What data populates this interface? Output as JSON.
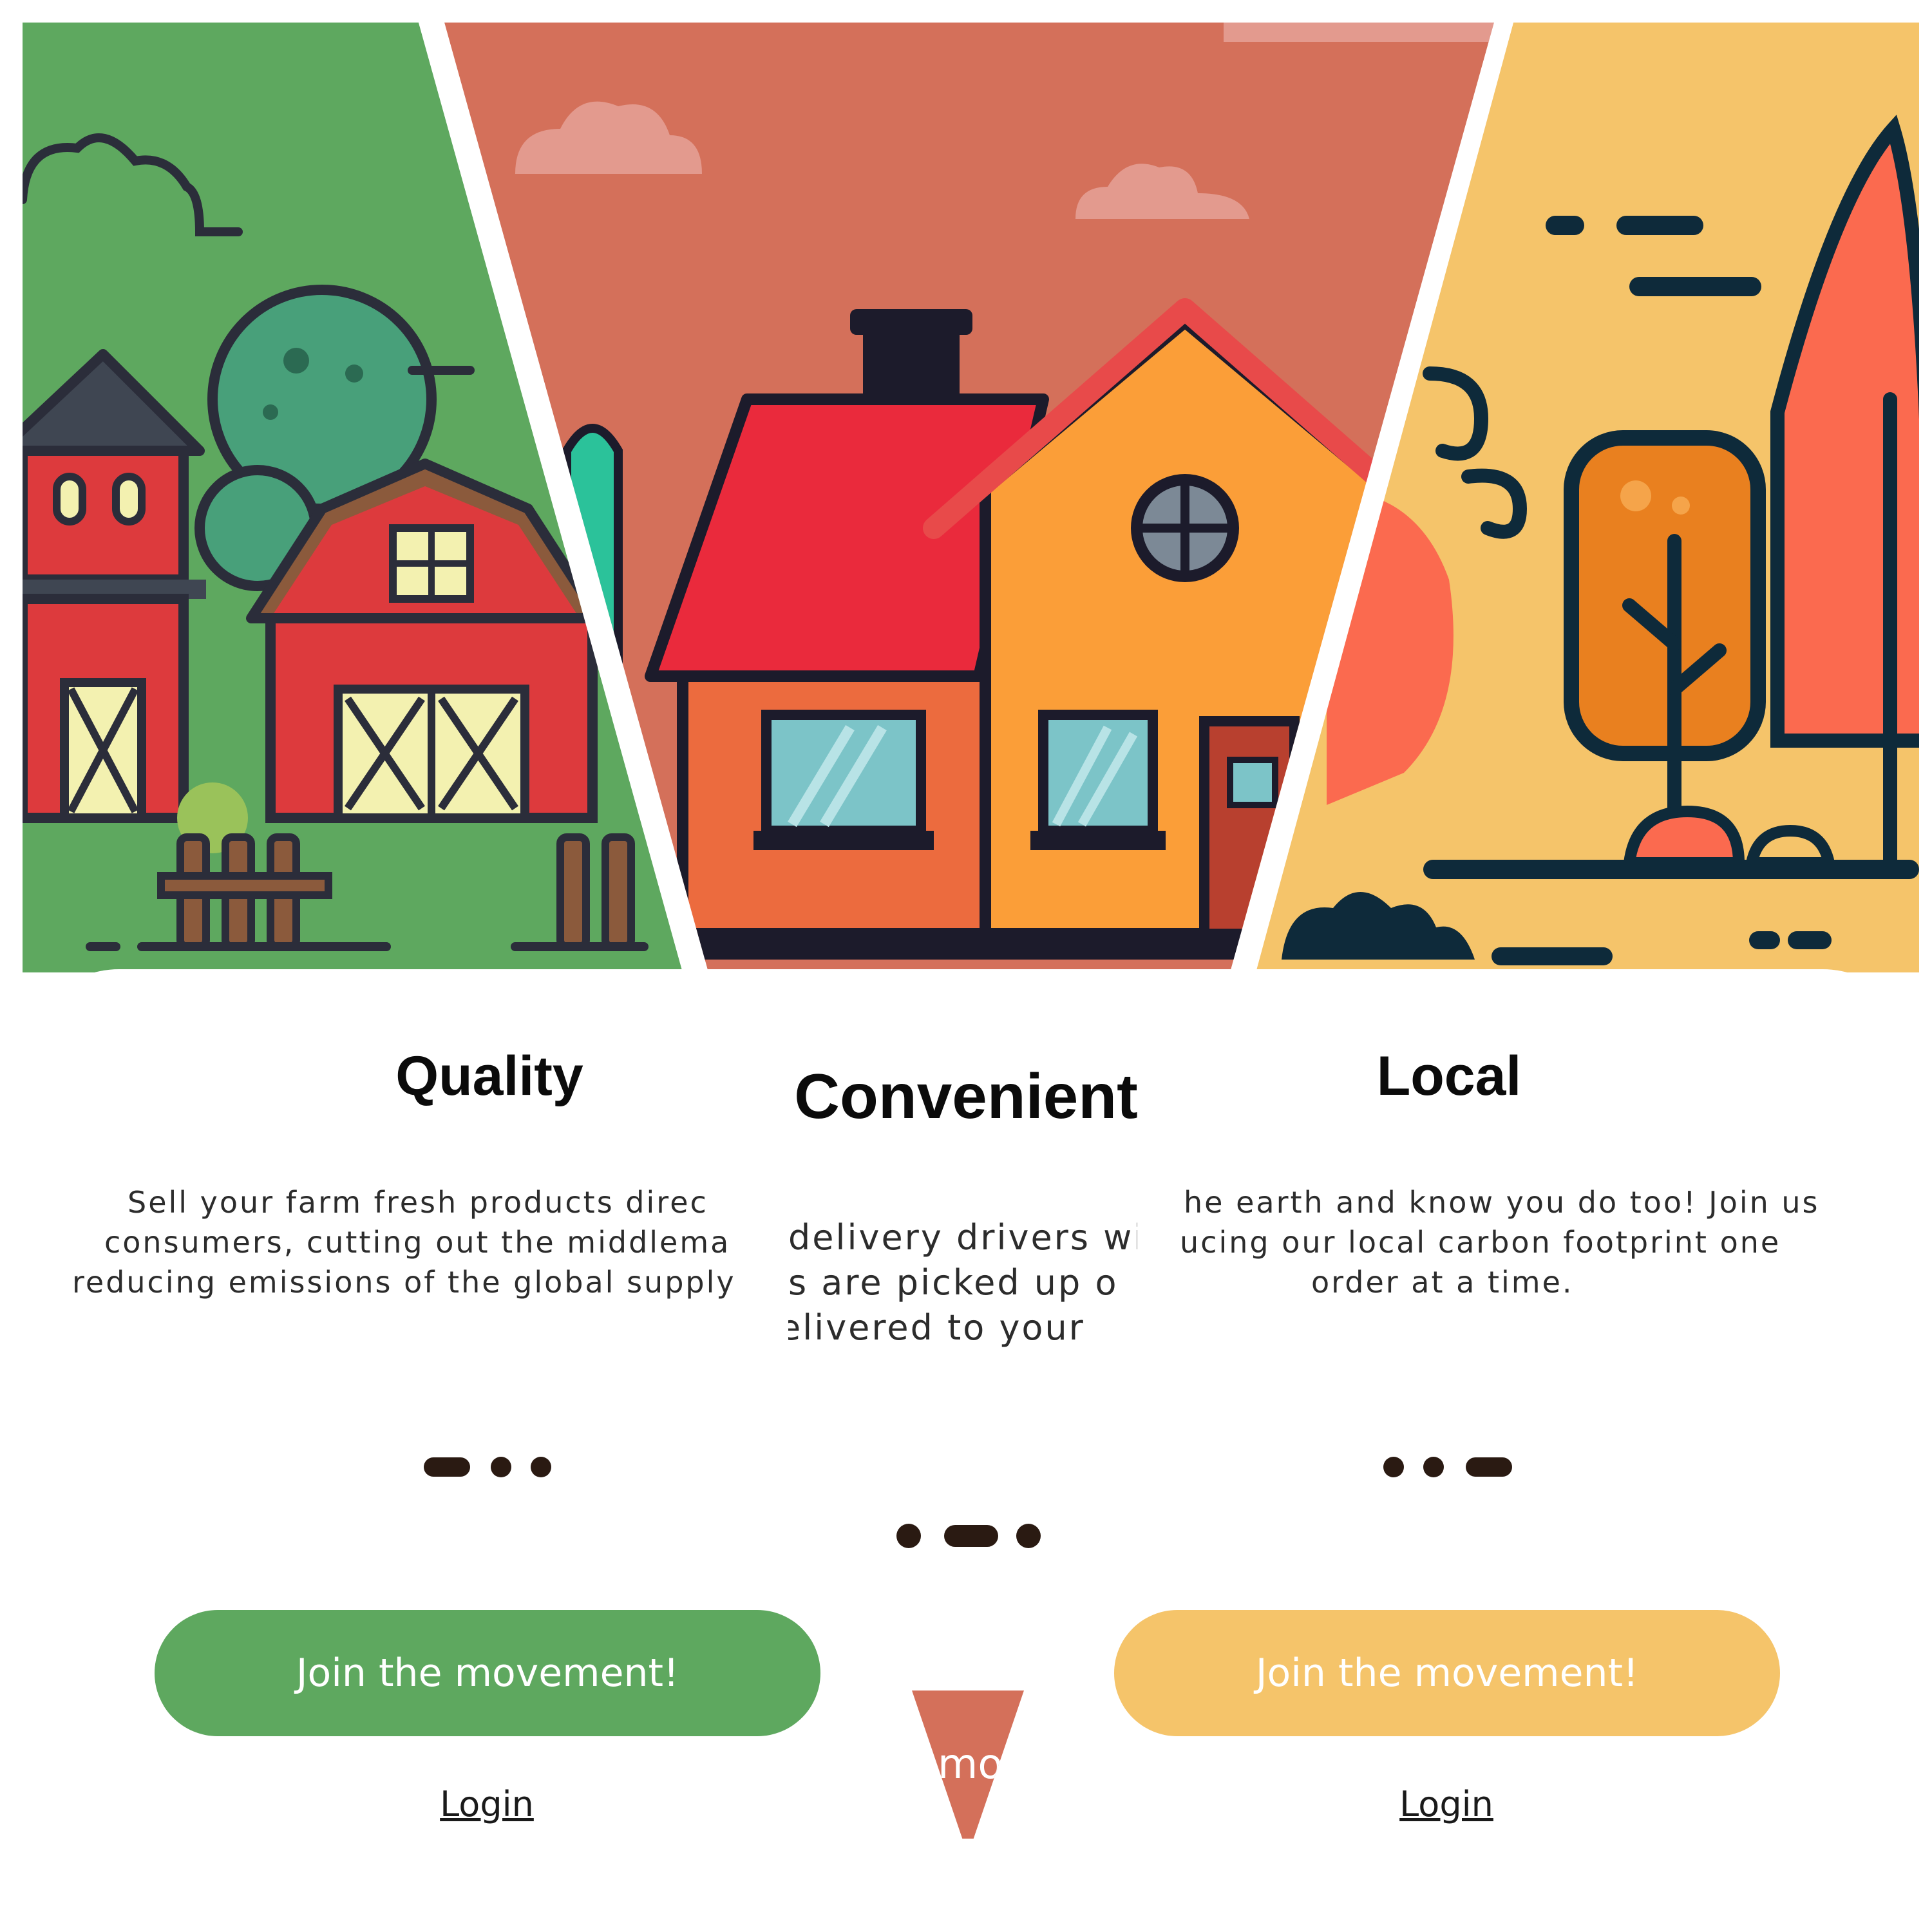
{
  "panels": [
    {
      "id": "quality",
      "title": "Quality",
      "description": [
        "Sell your farm fresh products direc",
        "consumers, cutting out the middlema",
        "reducing emissions of the global supply"
      ],
      "join_label": "Join the movement!",
      "login_label": "Login",
      "pager_active_index": 0,
      "accent_color": "#5ea85f"
    },
    {
      "id": "convenient",
      "title": "Convenient",
      "description": [
        "delivery drivers wi",
        "s are picked up o",
        "elivered to your"
      ],
      "join_label": "mo",
      "pager_active_index": 1,
      "accent_color": "#d4705a"
    },
    {
      "id": "local",
      "title": "Local",
      "description": [
        "he earth and know you do too! Join us",
        "ucing our local carbon footprint one",
        "order at a time."
      ],
      "join_label": "Join the movement!",
      "login_label": "Login",
      "pager_active_index": 2,
      "accent_color": "#f5c46a"
    }
  ],
  "illustrations": [
    "farm-barn-illustration",
    "house-illustration",
    "autumn-trees-illustration"
  ]
}
